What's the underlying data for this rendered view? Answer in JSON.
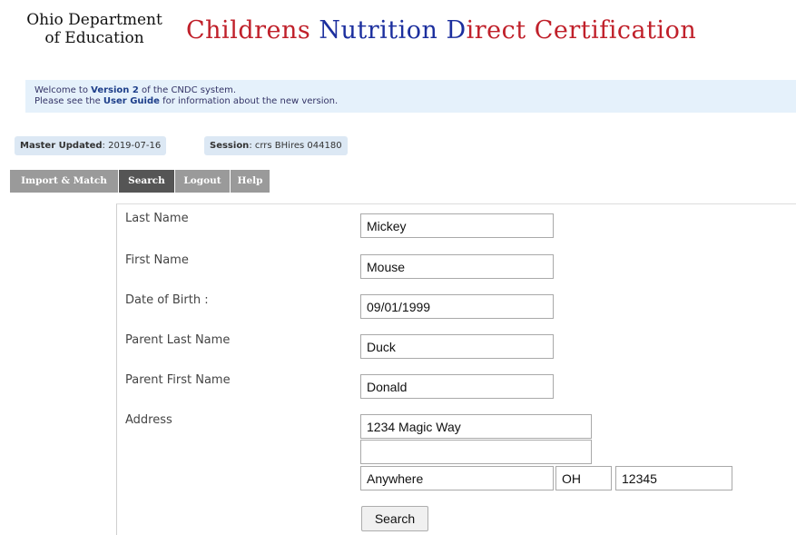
{
  "header": {
    "org_line1": "Ohio Department",
    "org_line2": "of Education",
    "title_parts": [
      "C",
      "hildrens ",
      "N",
      "utrition ",
      "D",
      "irect ",
      "C",
      "ertification"
    ]
  },
  "notice": {
    "line1_pre": "Welcome to ",
    "line1_bold": "Version 2",
    "line1_post": " of the CNDC system.",
    "line2_pre": "Please see the ",
    "line2_bold": "User Guide",
    "line2_post": " for information about the new version."
  },
  "status": {
    "master_label": "Master Updated",
    "master_value": ": 2019-07-16",
    "session_label": "Session",
    "session_value": ": crrs BHires 044180"
  },
  "nav": {
    "tabs": [
      "Import & Match",
      "Search",
      "Logout",
      "Help"
    ],
    "active": "Search"
  },
  "form": {
    "labels": {
      "last_name": "Last Name",
      "first_name": "First Name",
      "dob": "Date of Birth :",
      "parent_last_name": "Parent Last Name",
      "parent_first_name": "Parent First Name",
      "address": "Address"
    },
    "values": {
      "last_name": "Mickey",
      "first_name": "Mouse",
      "dob": "09/01/1999",
      "parent_last_name": "Duck",
      "parent_first_name": "Donald",
      "address1": "1234 Magic Way",
      "address2": "",
      "city": "Anywhere",
      "state": "OH",
      "zip": "12345"
    },
    "search_label": "Search"
  }
}
